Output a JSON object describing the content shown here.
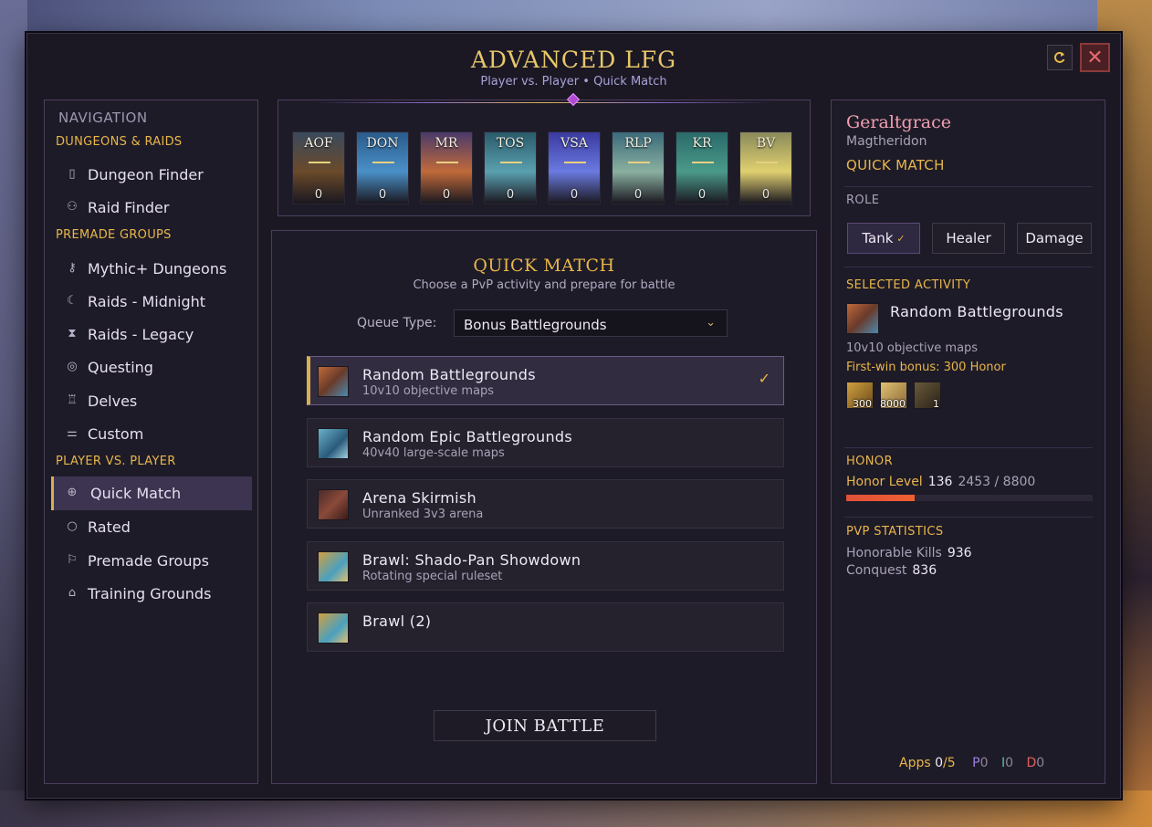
{
  "window": {
    "title": "ADVANCED LFG",
    "subtitle": "Player vs. Player • Quick Match",
    "reset_icon": "refresh-icon",
    "close_icon": "close-icon",
    "close_glyph": "✕"
  },
  "nav": {
    "heading": "NAVIGATION",
    "sections": {
      "dungeons": "DUNGEONS & RAIDS",
      "premade": "PREMADE GROUPS",
      "pvp": "PLAYER VS. PLAYER"
    },
    "items": [
      {
        "label": "Dungeon Finder",
        "icon": "door-icon"
      },
      {
        "label": "Raid Finder",
        "icon": "users-icon"
      },
      {
        "label": "Mythic+ Dungeons",
        "icon": "key-icon"
      },
      {
        "label": "Raids - Midnight",
        "icon": "moon-icon"
      },
      {
        "label": "Raids - Legacy",
        "icon": "hourglass-icon"
      },
      {
        "label": "Questing",
        "icon": "compass-icon"
      },
      {
        "label": "Delves",
        "icon": "lantern-icon"
      },
      {
        "label": "Custom",
        "icon": "sliders-icon"
      },
      {
        "label": "Quick Match",
        "icon": "crosshair-icon"
      },
      {
        "label": "Rated",
        "icon": "circle-icon"
      },
      {
        "label": "Premade Groups",
        "icon": "flag-icon"
      },
      {
        "label": "Training Grounds",
        "icon": "robot-icon"
      }
    ]
  },
  "strip": {
    "tiles": [
      {
        "abbr": "AOF",
        "count": "0",
        "color_top": "#3a4a5c",
        "color_bottom": "#6a4a2a"
      },
      {
        "abbr": "DON",
        "count": "0",
        "color_top": "#2a5a8a",
        "color_bottom": "#4a90c8"
      },
      {
        "abbr": "MR",
        "count": "0",
        "color_top": "#4a3a6a",
        "color_bottom": "#c06a3a"
      },
      {
        "abbr": "TOS",
        "count": "0",
        "color_top": "#2a5a6a",
        "color_bottom": "#5aa0b0"
      },
      {
        "abbr": "VSA",
        "count": "0",
        "color_top": "#3a3aa0",
        "color_bottom": "#6a7ae0"
      },
      {
        "abbr": "RLP",
        "count": "0",
        "color_top": "#3a6a7a",
        "color_bottom": "#8ab0a0"
      },
      {
        "abbr": "KR",
        "count": "0",
        "color_top": "#2a6a6a",
        "color_bottom": "#4a9a8a"
      },
      {
        "abbr": "BV",
        "count": "0",
        "color_top": "#8a8a5a",
        "color_bottom": "#e0d070"
      }
    ]
  },
  "quick_match": {
    "title": "QUICK MATCH",
    "subtitle": "Choose a PvP activity and prepare for battle",
    "queue_label": "Queue Type:",
    "queue_value": "Bonus Battlegrounds",
    "activities": [
      {
        "name": "Random Battlegrounds",
        "desc": "10v10 objective maps",
        "selected": true,
        "icon": "battleground-icon"
      },
      {
        "name": "Random Epic Battlegrounds",
        "desc": "40v40 large-scale maps",
        "selected": false,
        "icon": "epic-battleground-icon"
      },
      {
        "name": "Arena Skirmish",
        "desc": "Unranked 3v3 arena",
        "selected": false,
        "icon": "crossed-axes-icon"
      },
      {
        "name": "Brawl: Shado-Pan Showdown",
        "desc": "Rotating special ruleset",
        "selected": false,
        "icon": "brawl-icon"
      },
      {
        "name": "Brawl (2)",
        "desc": "",
        "selected": false,
        "icon": "brawl-icon"
      }
    ],
    "join_label": "JOIN BATTLE"
  },
  "profile": {
    "name": "Geraltgrace",
    "realm": "Magtheridon",
    "mode": "QUICK MATCH",
    "role_heading": "ROLE",
    "roles": [
      "Tank",
      "Healer",
      "Damage"
    ],
    "selected_role": "Tank",
    "selected_heading": "SELECTED ACTIVITY",
    "selected_name": "Random Battlegrounds",
    "selected_desc": "10v10 objective maps",
    "first_win": "First-win bonus: 300 Honor",
    "rewards": [
      {
        "qty": "300",
        "icon": "honor-icon"
      },
      {
        "qty": "8000",
        "icon": "conquest-icon"
      },
      {
        "qty": "1",
        "icon": "chest-icon"
      }
    ],
    "honor_heading": "HONOR",
    "honor_label": "Honor Level",
    "honor_level": "136",
    "honor_progress": "2453 / 8800",
    "honor_fraction": 0.279,
    "stats_heading": "PVP STATISTICS",
    "kills_label": "Honorable Kills",
    "kills_value": "936",
    "conquest_label": "Conquest",
    "conquest_value": "836",
    "apps_label": "Apps",
    "apps_count": "0",
    "apps_total": "/5",
    "apps_p": "P",
    "apps_p_val": "0",
    "apps_t": "I",
    "apps_t_val": "0",
    "apps_d": "D",
    "apps_d_val": "0"
  }
}
